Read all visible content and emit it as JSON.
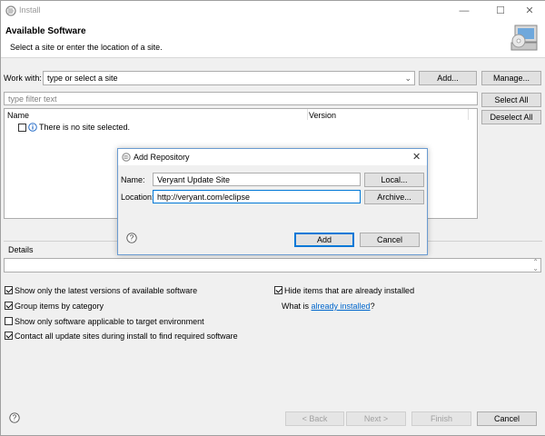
{
  "window": {
    "title": "Install",
    "minimize": "—",
    "maximize": "☐",
    "close": "✕"
  },
  "header": {
    "title": "Available Software",
    "subtitle": "Select a site or enter the location of a site."
  },
  "work_with": {
    "label": "Work with:",
    "placeholder": "type or select a site",
    "add_label": "Add...",
    "manage_label": "Manage..."
  },
  "filter": {
    "placeholder": "type filter text",
    "select_all_label": "Select All",
    "deselect_all_label": "Deselect All"
  },
  "tree": {
    "columns": [
      "Name",
      "Version"
    ],
    "empty_message": "There is no site selected."
  },
  "details": {
    "label": "Details"
  },
  "options": {
    "left": [
      {
        "label": "Show only the latest versions of available software",
        "checked": true
      },
      {
        "label": "Group items by category",
        "checked": true
      },
      {
        "label": "Show only software applicable to target environment",
        "checked": false
      },
      {
        "label": "Contact all update sites during install to find required software",
        "checked": true
      }
    ],
    "hide_installed": {
      "label": "Hide items that are already installed",
      "checked": true
    },
    "what_is_prefix": "What is ",
    "what_is_link": "already installed",
    "what_is_suffix": "?"
  },
  "footer": {
    "back_label": "< Back",
    "next_label": "Next >",
    "finish_label": "Finish",
    "cancel_label": "Cancel"
  },
  "add_repository": {
    "title": "Add Repository",
    "name_label": "Name:",
    "name_value": "Veryant Update Site",
    "location_label": "Location:",
    "location_value": "http://veryant.com/eclipse",
    "local_label": "Local...",
    "archive_label": "Archive...",
    "add_label": "Add",
    "cancel_label": "Cancel"
  }
}
